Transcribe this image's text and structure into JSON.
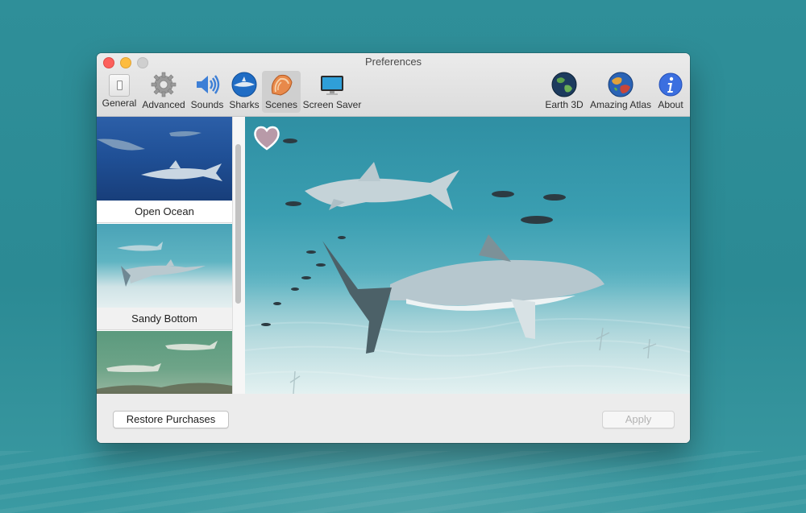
{
  "window": {
    "title": "Preferences"
  },
  "toolbar": {
    "items": [
      {
        "label": "General",
        "icon": "switch-icon"
      },
      {
        "label": "Advanced",
        "icon": "gear-icon"
      },
      {
        "label": "Sounds",
        "icon": "speaker-icon"
      },
      {
        "label": "Sharks",
        "icon": "shark-icon"
      },
      {
        "label": "Scenes",
        "icon": "seashell-icon",
        "active": true
      },
      {
        "label": "Screen Saver",
        "icon": "monitor-icon"
      },
      {
        "label": "Earth 3D",
        "icon": "earth-globe-icon"
      },
      {
        "label": "Amazing Atlas",
        "icon": "atlas-globe-icon"
      },
      {
        "label": "About",
        "icon": "info-icon"
      }
    ]
  },
  "scenes": [
    {
      "label": "Open Ocean",
      "selected": true
    },
    {
      "label": "Sandy Bottom"
    },
    {
      "label": ""
    }
  ],
  "footer": {
    "restore_label": "Restore Purchases",
    "apply_label": "Apply"
  },
  "colors": {
    "active_tab_bg": "#cfcfcf",
    "close": "#fc605c",
    "minimize": "#fdbc40",
    "zoom_disabled": "#cfcfcf",
    "about_icon": "#3b6fe0"
  }
}
